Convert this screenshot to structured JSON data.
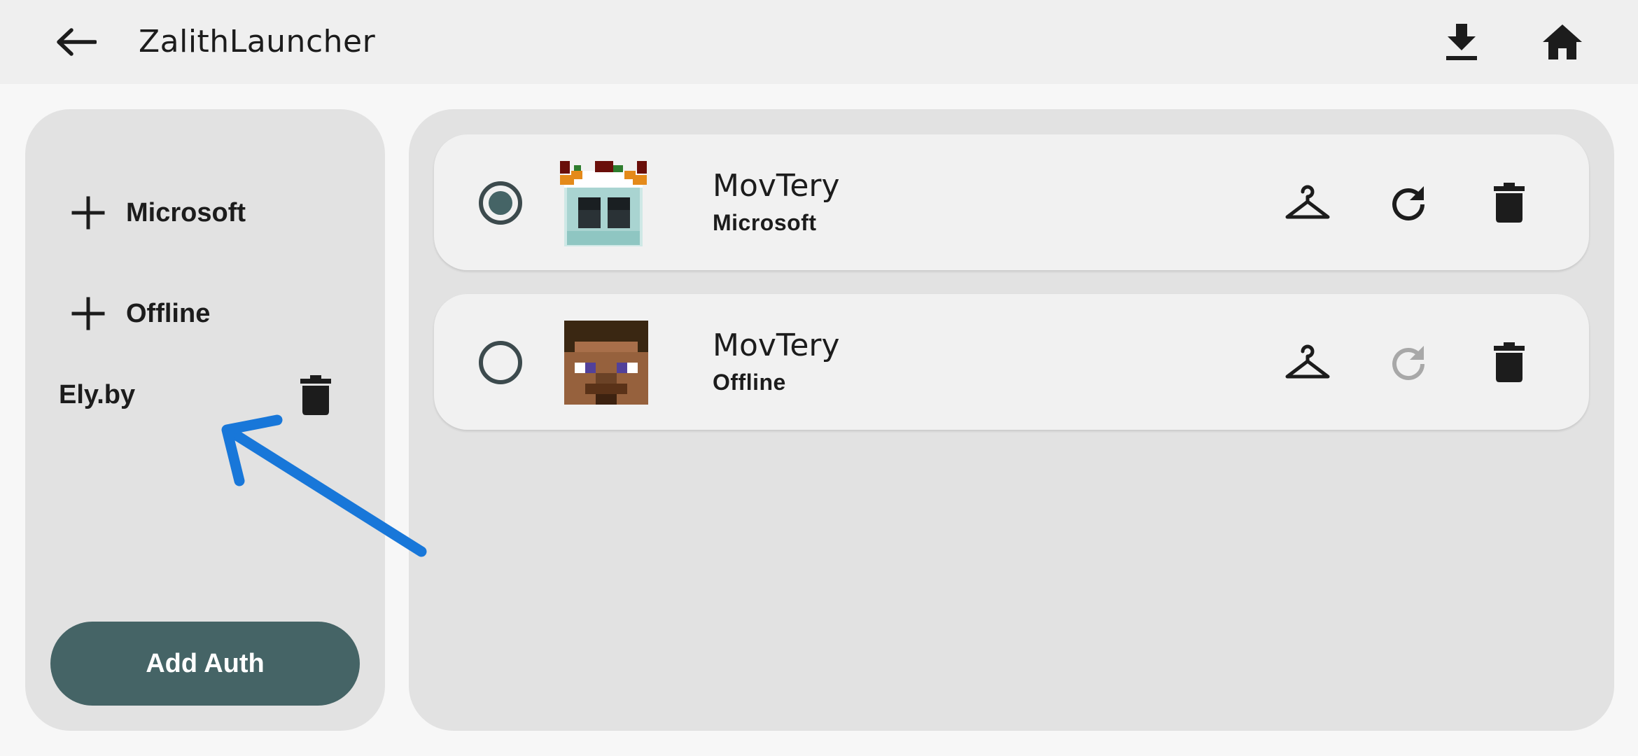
{
  "header": {
    "title": "ZalithLauncher",
    "back_icon": "arrow-back-icon",
    "download_icon": "download-icon",
    "home_icon": "home-icon"
  },
  "sidebar": {
    "auth_types": [
      {
        "label": "Microsoft",
        "icon": "plus-icon"
      },
      {
        "label": "Offline",
        "icon": "plus-icon"
      }
    ],
    "servers": [
      {
        "label": "Ely.by",
        "action_icon": "trash-icon"
      }
    ],
    "add_auth_label": "Add Auth"
  },
  "accounts": [
    {
      "name": "MovTery",
      "type": "Microsoft",
      "selected": true,
      "refresh_enabled": true
    },
    {
      "name": "MovTery",
      "type": "Offline",
      "selected": false,
      "refresh_enabled": false
    }
  ],
  "colors": {
    "accent": "#456466",
    "panel": "#e2e2e2",
    "card": "#f1f1f1",
    "annotation_arrow": "#1877d9",
    "disabled_icon": "#a8a8a8"
  }
}
